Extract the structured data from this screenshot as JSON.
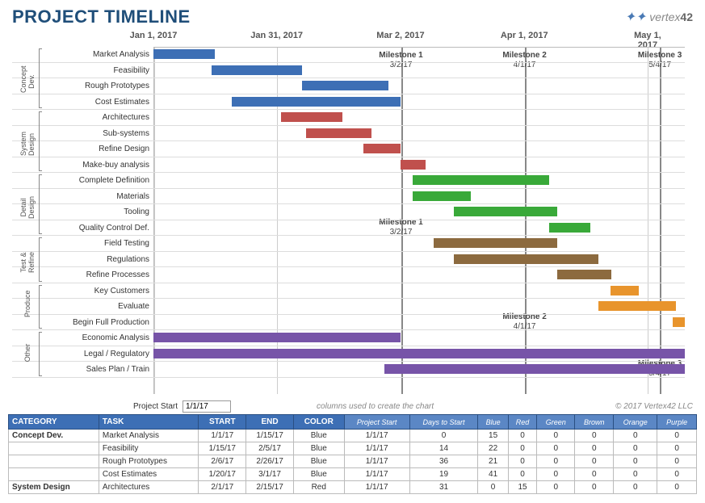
{
  "title": "PROJECT TIMELINE",
  "logo_text": "vertex",
  "logo_suffix": "42",
  "meta": {
    "project_start_label": "Project Start",
    "project_start_value": "1/1/17",
    "hint": "columns used to create the chart",
    "copyright": "© 2017 Vertex42 LLC"
  },
  "chart_data": {
    "type": "gantt",
    "x_axis": {
      "start": "2017-01-01",
      "end": "2017-05-10",
      "ticks": [
        {
          "label": "Jan 1, 2017",
          "pos": 0.0
        },
        {
          "label": "Jan 31, 2017",
          "pos": 0.232
        },
        {
          "label": "Mar 2, 2017",
          "pos": 0.465
        },
        {
          "label": "Apr 1, 2017",
          "pos": 0.698
        },
        {
          "label": "May 1, 2017",
          "pos": 0.93
        }
      ]
    },
    "milestones": [
      {
        "name": "Milestone 1",
        "date": "3/2/17",
        "pos": 0.465,
        "label_rows": [
          0,
          11
        ]
      },
      {
        "name": "Milestone 2",
        "date": "4/1/17",
        "pos": 0.698,
        "label_rows": [
          0,
          17
        ]
      },
      {
        "name": "Milestone 3",
        "date": "5/4/17",
        "pos": 0.953,
        "label_rows": [
          0,
          20
        ]
      }
    ],
    "groups": [
      {
        "name": "Concept Dev.",
        "rows": [
          "Market Analysis",
          "Feasibility",
          "Rough Prototypes",
          "Cost Estimates"
        ]
      },
      {
        "name": "System Design",
        "rows": [
          "Architectures",
          "Sub-systems",
          "Refine Design",
          "Make-buy analysis"
        ]
      },
      {
        "name": "Detail Design",
        "rows": [
          "Complete Definition",
          "Materials",
          "Tooling",
          "Quality Control Def."
        ]
      },
      {
        "name": "Test & Refine",
        "rows": [
          "Field Testing",
          "Regulations",
          "Refine Processes"
        ]
      },
      {
        "name": "Produce",
        "rows": [
          "Key Customers",
          "Evaluate",
          "Begin Full Production"
        ]
      },
      {
        "name": "Other",
        "rows": [
          "Economic Analysis",
          "Legal / Regulatory",
          "Sales Plan / Train"
        ]
      }
    ],
    "bars": [
      {
        "row": 0,
        "start": 0.0,
        "dur": 0.116,
        "color": "blue"
      },
      {
        "row": 1,
        "start": 0.109,
        "dur": 0.17,
        "color": "blue"
      },
      {
        "row": 2,
        "start": 0.279,
        "dur": 0.163,
        "color": "blue"
      },
      {
        "row": 3,
        "start": 0.147,
        "dur": 0.318,
        "color": "blue"
      },
      {
        "row": 4,
        "start": 0.24,
        "dur": 0.116,
        "color": "red"
      },
      {
        "row": 5,
        "start": 0.287,
        "dur": 0.124,
        "color": "red"
      },
      {
        "row": 6,
        "start": 0.395,
        "dur": 0.07,
        "color": "red"
      },
      {
        "row": 7,
        "start": 0.465,
        "dur": 0.047,
        "color": "red"
      },
      {
        "row": 8,
        "start": 0.488,
        "dur": 0.256,
        "color": "green"
      },
      {
        "row": 9,
        "start": 0.488,
        "dur": 0.109,
        "color": "green"
      },
      {
        "row": 10,
        "start": 0.566,
        "dur": 0.194,
        "color": "green"
      },
      {
        "row": 11,
        "start": 0.744,
        "dur": 0.078,
        "color": "green"
      },
      {
        "row": 12,
        "start": 0.527,
        "dur": 0.233,
        "color": "brown"
      },
      {
        "row": 13,
        "start": 0.566,
        "dur": 0.271,
        "color": "brown"
      },
      {
        "row": 14,
        "start": 0.76,
        "dur": 0.101,
        "color": "brown"
      },
      {
        "row": 15,
        "start": 0.86,
        "dur": 0.054,
        "color": "orange"
      },
      {
        "row": 16,
        "start": 0.837,
        "dur": 0.147,
        "color": "orange"
      },
      {
        "row": 17,
        "start": 0.977,
        "dur": 0.023,
        "color": "orange"
      },
      {
        "row": 18,
        "start": 0.0,
        "dur": 0.465,
        "color": "purple"
      },
      {
        "row": 19,
        "start": 0.0,
        "dur": 1.0,
        "color": "purple"
      },
      {
        "row": 20,
        "start": 0.434,
        "dur": 0.566,
        "color": "purple"
      }
    ]
  },
  "table": {
    "headers": [
      "CATEGORY",
      "TASK",
      "START",
      "END",
      "COLOR"
    ],
    "sub_headers": [
      "Project Start",
      "Days to Start",
      "Blue",
      "Red",
      "Green",
      "Brown",
      "Orange",
      "Purple"
    ],
    "rows": [
      {
        "category": "Concept Dev.",
        "task": "Market Analysis",
        "start": "1/1/17",
        "end": "1/15/17",
        "color": "Blue",
        "ps": "1/1/17",
        "dts": "0",
        "blue": "15",
        "red": "0",
        "green": "0",
        "brown": "0",
        "orange": "0",
        "purple": "0"
      },
      {
        "category": "",
        "task": "Feasibility",
        "start": "1/15/17",
        "end": "2/5/17",
        "color": "Blue",
        "ps": "1/1/17",
        "dts": "14",
        "blue": "22",
        "red": "0",
        "green": "0",
        "brown": "0",
        "orange": "0",
        "purple": "0"
      },
      {
        "category": "",
        "task": "Rough Prototypes",
        "start": "2/6/17",
        "end": "2/26/17",
        "color": "Blue",
        "ps": "1/1/17",
        "dts": "36",
        "blue": "21",
        "red": "0",
        "green": "0",
        "brown": "0",
        "orange": "0",
        "purple": "0"
      },
      {
        "category": "",
        "task": "Cost Estimates",
        "start": "1/20/17",
        "end": "3/1/17",
        "color": "Blue",
        "ps": "1/1/17",
        "dts": "19",
        "blue": "41",
        "red": "0",
        "green": "0",
        "brown": "0",
        "orange": "0",
        "purple": "0"
      },
      {
        "category": "System Design",
        "task": "Architectures",
        "start": "2/1/17",
        "end": "2/15/17",
        "color": "Red",
        "ps": "1/1/17",
        "dts": "31",
        "blue": "0",
        "red": "15",
        "green": "0",
        "brown": "0",
        "orange": "0",
        "purple": "0"
      }
    ]
  }
}
